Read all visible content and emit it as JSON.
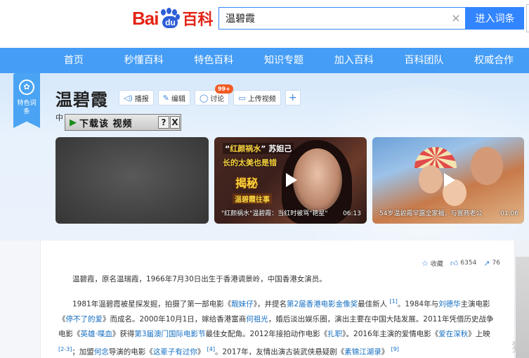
{
  "header": {
    "logo": {
      "bai": "Bai",
      "du": "du",
      "baike": "百科"
    },
    "search_value": "温碧霞",
    "clear_icon": "×",
    "search_button": "进入词条"
  },
  "nav": [
    "首页",
    "秒懂百科",
    "特色百科",
    "知识专题",
    "加入百科",
    "百科团队",
    "权威合作"
  ],
  "ribbon": {
    "text": "特色词条",
    "icon": "✿"
  },
  "entry": {
    "title": "温碧霞",
    "tools": {
      "report": "播报",
      "edit": "编辑",
      "discuss": "讨论",
      "discuss_badge": "99+",
      "upload": "上传视频",
      "add": "+"
    },
    "zh_char": "中"
  },
  "download_bar": {
    "label": "下载该 视频",
    "help": "?",
    "close": "X"
  },
  "videos": [
    {
      "caption": "",
      "duration": ""
    },
    {
      "top_q": "红颜祸水",
      "top_rest": "苏妲己",
      "sub": "长的太美也是错",
      "big": "揭秘",
      "name": "温碧霞往事",
      "caption": "\"红颜祸水\"温碧霞：当红时被骂\"艳星\"",
      "duration": "06:13"
    },
    {
      "caption": "54岁温碧霞罕露全家福，与富商老公",
      "duration": "01:06"
    }
  ],
  "stats": {
    "collect": "收藏",
    "likes": "6354",
    "shares": "76"
  },
  "paragraphs": {
    "p1": "温碧霞，原名温瑞霞，1966年7月30日出生于香港调景岭，中国香港女演员。",
    "p2": {
      "t1": "1981年温碧霞被星探发掘，拍摄了第一部电影《",
      "l1": "靓妹仔",
      "t2": "》，并提名",
      "l2": "第2届香港电影金像奖",
      "t3": "最佳新人 ",
      "s1": "[1]",
      "t4": "。1984年与",
      "l3": "刘德华",
      "t5": "主演电影《",
      "l4": "停不了的爱",
      "t6": "》而成名。2000年10月1日，嫁给香港富商",
      "l5": "何祖光",
      "t7": "，婚后淡出娱乐圈，演出主要在中国大陆发展。2011年凭借历史战争电影《",
      "l6": "英雄·喋血",
      "t8": "》获得",
      "l7": "第3届澳门国际电影节",
      "t9": "最佳女配角。2012年接拍动作电影《",
      "l8": "扎职",
      "t10": "》。2016年主演的爱情电影《",
      "l9": "爱在深秋",
      "t11": "》上映 ",
      "s2": "[2-3]",
      "t12": "；加盟",
      "l10": "何念",
      "t13": "导演的电影《",
      "l11": "这辈子有过你",
      "t14": "》 ",
      "s3": "[4]",
      "t15": "。2017年，友情出演古装武侠悬疑剧《",
      "l12": "素锦江湖录",
      "t16": "》 ",
      "s4": "[9]"
    }
  },
  "watermark": "猫",
  "colors": {
    "nav": "#459df5",
    "accent": "#3385ff",
    "link": "#136ec2",
    "logo_red": "#e32417",
    "logo_blue": "#2e5fd8",
    "badge": "#f15b24"
  }
}
